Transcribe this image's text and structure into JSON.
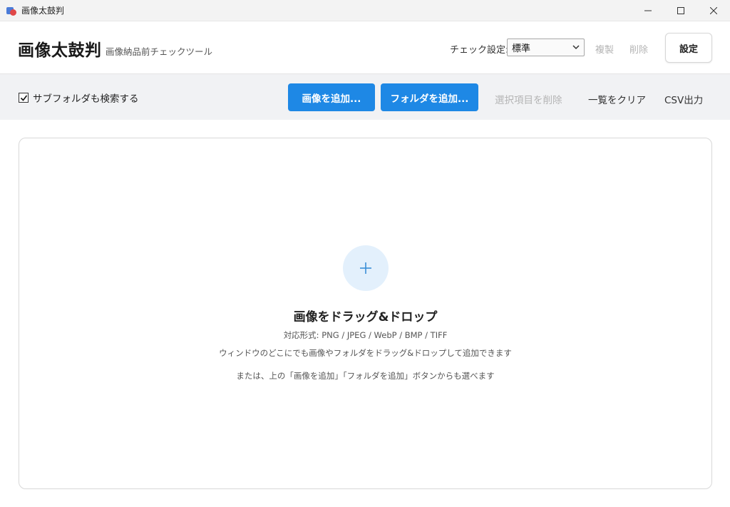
{
  "window": {
    "title": "画像太鼓判",
    "controls": {
      "minimize": "—",
      "maximize": "☐",
      "close": "✕"
    }
  },
  "header": {
    "title": "画像太鼓判",
    "subtitle": "画像納品前チェックツール",
    "check_settings_label": "チェック設定:",
    "check_settings_value": "標準",
    "duplicate_label": "複製",
    "delete_label": "削除",
    "settings_label": "設定"
  },
  "toolbar": {
    "subfolder_label": "サブフォルダも検索する",
    "subfolder_checked": true,
    "add_images_label": "画像を追加...",
    "add_folder_label": "フォルダを追加...",
    "remove_selected_label": "選択項目を削除",
    "clear_list_label": "一覧をクリア",
    "csv_export_label": "CSV出力"
  },
  "dropzone": {
    "title": "画像をドラッグ&ドロップ",
    "formats": "対応形式: PNG / JPEG / WebP / BMP / TIFF",
    "hint1": "ウィンドウのどこにでも画像やフォルダをドラッグ&ドロップして追加できます",
    "hint2": "または、上の「画像を追加」「フォルダを追加」ボタンからも選べます"
  },
  "colors": {
    "accent": "#1e88e5",
    "disabled_text": "#b4b4b4",
    "toolbar_bg": "#f1f2f4",
    "plus_bg": "#e3f0fc"
  }
}
